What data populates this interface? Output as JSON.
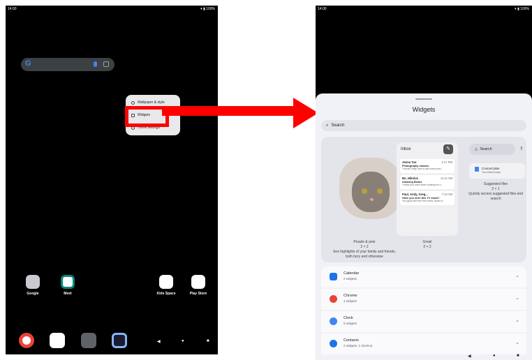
{
  "left": {
    "status": {
      "time": "14:00",
      "battery": "▾ ▮ 100%"
    },
    "search_g": "G",
    "popup": [
      {
        "label": "Wallpaper & style"
      },
      {
        "label": "Widgets"
      },
      {
        "label": "Home settings"
      }
    ],
    "apps": [
      {
        "label": "Google"
      },
      {
        "label": "Meet"
      },
      {
        "label": "Kids Space"
      },
      {
        "label": "Play Store"
      }
    ],
    "nav": {
      "back": "◀",
      "home": "●",
      "recents": "■"
    }
  },
  "right": {
    "status": {
      "time": "14:00",
      "battery": "▾ ▮ 100%"
    },
    "sheet_title": "Widgets",
    "search_placeholder": "Search",
    "people": {
      "name": "People & pets",
      "size": "2 × 2",
      "desc": "See highlights of your family and friends, both furry and otherwise"
    },
    "gmail": {
      "inbox": "Inbox",
      "name": "Gmail",
      "size": "2 × 2",
      "mails": [
        {
          "from": "Jenna Tan",
          "time": "2:17 PM",
          "subject": "Photography classes",
          "snippet": "I would really love to get some pho..."
        },
        {
          "from": "Bo, Nikolus",
          "time": "11:11 AM",
          "subject": "Amazing Books",
          "snippet": "I know you have been looking for b..."
        },
        {
          "from": "Paul, Andy, Greg...",
          "time": "7:13 AM",
          "subject": "Have you seen this TV show?",
          "snippet": "You guys will love this show. Arуна a..."
        }
      ]
    },
    "drive": {
      "search": "Search",
      "card_name": "Concert plan",
      "card_sub": "You edited today",
      "name": "Suggested files",
      "size": "2 × 1",
      "desc": "Quickly access suggested files and search"
    },
    "list": [
      {
        "name": "Calendar",
        "sub": "2 widgets",
        "color": "#1a73e8"
      },
      {
        "name": "Chrome",
        "sub": "4 widgets",
        "color": "#ea4335"
      },
      {
        "name": "Clock",
        "sub": "5 widgets",
        "color": "#4285f4"
      },
      {
        "name": "Contacts",
        "sub": "2 widgets, 1 shortcut",
        "color": "#1a73e8"
      }
    ],
    "nav": {
      "back": "◀",
      "home": "●",
      "recents": "■"
    }
  },
  "colors": {
    "highlight": "#ff0000",
    "sheet": "#f1f2f5"
  }
}
